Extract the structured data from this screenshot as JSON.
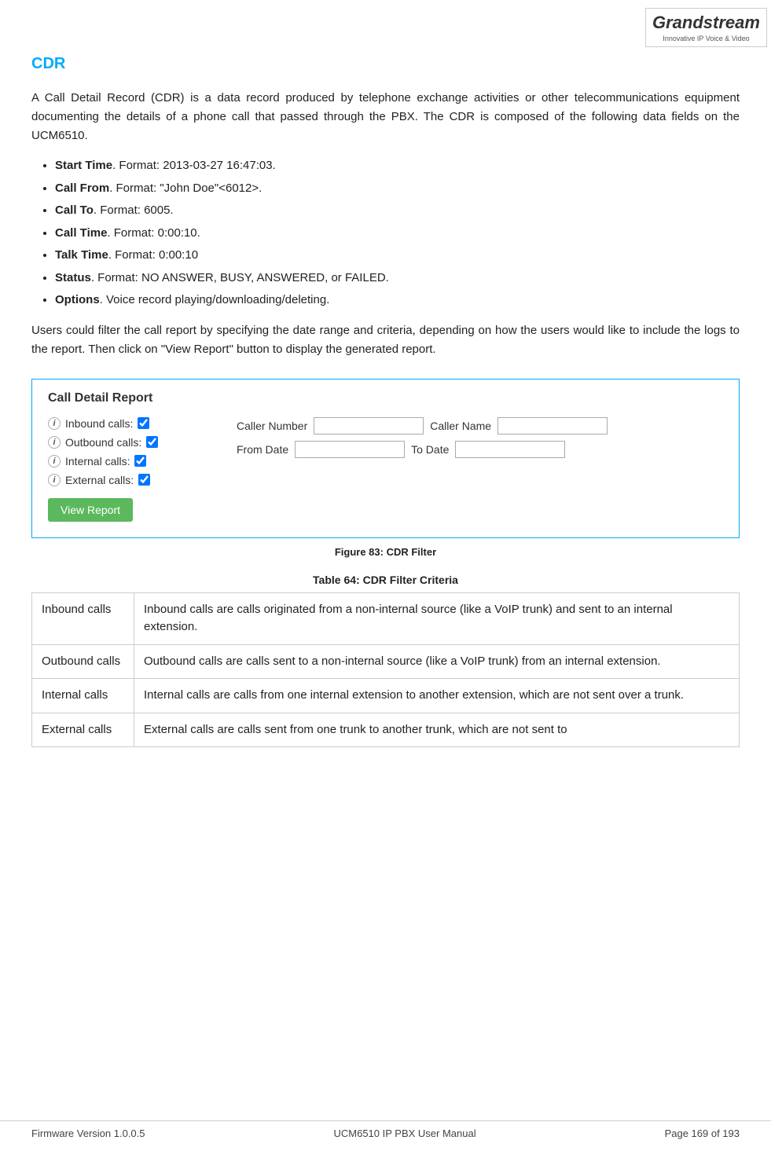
{
  "header": {
    "logo_letter": "G",
    "logo_brand": "andstream",
    "logo_tagline": "Innovative IP Voice & Video"
  },
  "page": {
    "title": "CDR",
    "intro": "A Call Detail Record (CDR) is a data record produced by telephone exchange activities or other telecommunications equipment documenting the details of a phone call that passed through the PBX. The CDR is composed of the following data fields on the UCM6510.",
    "bullets": [
      {
        "label": "Start Time",
        "text": ". Format: 2013-03-27 16:47:03."
      },
      {
        "label": "Call From",
        "text": ". Format: \"John Doe\"<6012>."
      },
      {
        "label": "Call To",
        "text": ". Format: 6005."
      },
      {
        "label": "Call Time",
        "text": ". Format: 0:00:10."
      },
      {
        "label": "Talk Time",
        "text": ". Format: 0:00:10"
      },
      {
        "label": "Status",
        "text": ". Format: NO ANSWER, BUSY, ANSWERED, or FAILED."
      },
      {
        "label": "Options",
        "text": ". Voice record playing/downloading/deleting."
      }
    ],
    "filter_para": "Users could filter the call report by specifying the date range and criteria, depending on how the users would like to include the logs to the report. Then click on \"View Report\" button to display the generated report."
  },
  "cdr_filter_box": {
    "title": "Call Detail Report",
    "left_rows": [
      {
        "label": "Inbound calls:",
        "checked": true
      },
      {
        "label": "Outbound calls:",
        "checked": true
      },
      {
        "label": "Internal calls:",
        "checked": true
      },
      {
        "label": "External calls:",
        "checked": true
      }
    ],
    "right_rows": [
      {
        "label1": "Caller Number",
        "input1_value": "",
        "label2": "Caller Name",
        "input2_value": ""
      },
      {
        "label1": "From Date",
        "input1_value": "",
        "label2": "To Date",
        "input2_value": ""
      }
    ],
    "view_report_btn": "View Report"
  },
  "figure_caption": "Figure 83: CDR Filter",
  "table": {
    "caption": "Table 64: CDR Filter Criteria",
    "rows": [
      {
        "term": "Inbound calls",
        "definition": "Inbound calls are calls originated from a non-internal source (like a VoIP trunk) and sent to an internal extension."
      },
      {
        "term": "Outbound calls",
        "definition": "Outbound calls are calls sent to a non-internal source (like a VoIP trunk) from an internal extension."
      },
      {
        "term": "Internal calls",
        "definition": "Internal calls are calls from one internal extension to another extension, which are not sent over a trunk."
      },
      {
        "term": "External calls",
        "definition": "External calls are calls sent from one trunk to another trunk, which are not sent to"
      }
    ]
  },
  "footer": {
    "left": "Firmware Version 1.0.0.5",
    "center": "UCM6510 IP PBX User Manual",
    "right": "Page 169 of 193"
  }
}
